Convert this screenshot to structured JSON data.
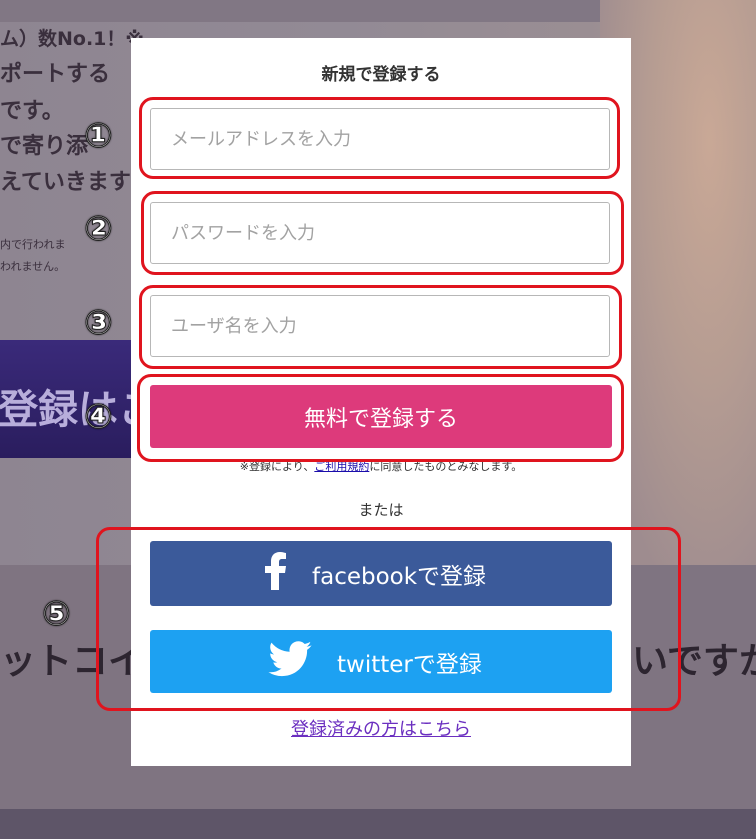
{
  "background": {
    "lines": [
      "ム）数No.1！※",
      "ポートする",
      "です。",
      "で寄り添",
      "えていきます"
    ],
    "small_lines": [
      "内で行われま",
      "われません。"
    ],
    "banner_text": "登録はこ",
    "big_left": "ットコイ",
    "big_right": "いですか"
  },
  "modal": {
    "title": "新規で登録する",
    "email_placeholder": "メールアドレスを入力",
    "password_placeholder": "パスワードを入力",
    "username_placeholder": "ユーザ名を入力",
    "submit_label": "無料で登録する",
    "terms_prefix": "※登録により、",
    "terms_link": "ご利用規約",
    "terms_suffix": "に同意したものとみなします。",
    "or_label": "または",
    "facebook_label": "facebookで登録",
    "twitter_label": "twitterで登録",
    "login_link": "登録済みの方はこちら"
  },
  "annotations": {
    "n1": "①",
    "n2": "②",
    "n3": "③",
    "n4": "④",
    "n5": "⑤"
  },
  "colors": {
    "submit": "#dd3a7b",
    "facebook": "#3b5a9a",
    "twitter": "#1da1f2",
    "annotation_frame": "#e0141e"
  }
}
